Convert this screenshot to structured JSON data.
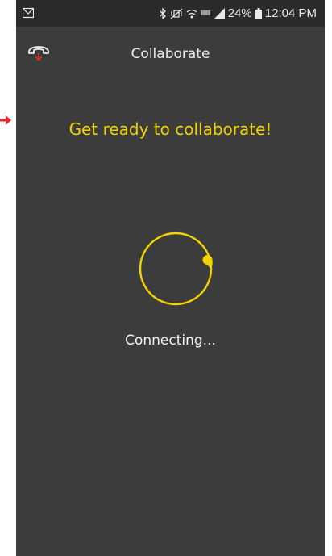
{
  "status_bar": {
    "left_icon": "gmail-icon",
    "icons": [
      "bluetooth-icon",
      "mute-icon",
      "wifi-icon",
      "lte-icon",
      "signal-icon",
      "battery-icon"
    ],
    "battery_percent": "24%",
    "time": "12:04 PM"
  },
  "app_bar": {
    "title": "Collaborate",
    "left_icon": "hang-up-icon"
  },
  "content": {
    "headline": "Get ready to collaborate!",
    "status": "Connecting..."
  },
  "colors": {
    "background": "#3c3c3c",
    "status_bar": "#2b2b2b",
    "accent": "#f2d300",
    "hangup_accent": "#e0312b",
    "pointer_arrow": "#e8252b"
  }
}
